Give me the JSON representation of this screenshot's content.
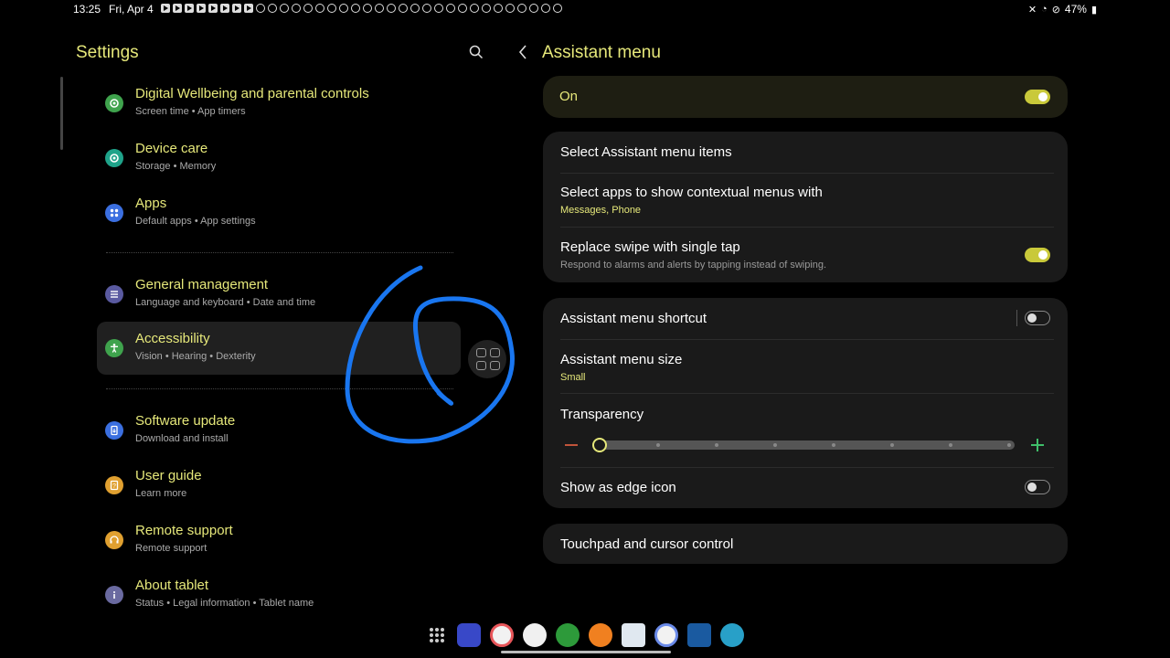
{
  "status": {
    "time": "13:25",
    "date": "Fri, Apr 4",
    "battery": "47%"
  },
  "left": {
    "title": "Settings",
    "items": [
      {
        "title": "Digital Wellbeing and parental controls",
        "sub": "Screen time  •  App timers",
        "color": "#3fa34d"
      },
      {
        "title": "Device care",
        "sub": "Storage  •  Memory",
        "color": "#1fa38a"
      },
      {
        "title": "Apps",
        "sub": "Default apps  •  App settings",
        "color": "#3b6fe0"
      },
      {
        "title": "General management",
        "sub": "Language and keyboard  •  Date and time",
        "color": "#5a5aa0"
      },
      {
        "title": "Accessibility",
        "sub": "Vision  •  Hearing  •  Dexterity",
        "color": "#3fa34d"
      },
      {
        "title": "Software update",
        "sub": "Download and install",
        "color": "#3b6fe0"
      },
      {
        "title": "User guide",
        "sub": "Learn more",
        "color": "#e0a030"
      },
      {
        "title": "Remote support",
        "sub": "Remote support",
        "color": "#e0a030"
      },
      {
        "title": "About tablet",
        "sub": "Status  •  Legal information  •  Tablet name",
        "color": "#6a6aa0"
      }
    ]
  },
  "right": {
    "title": "Assistant menu",
    "on_label": "On",
    "main_toggle": true,
    "group1": {
      "select_items": "Select Assistant menu items",
      "contextual_title": "Select apps to show contextual menus with",
      "contextual_sub": "Messages, Phone",
      "replace_title": "Replace swipe with single tap",
      "replace_sub": "Respond to alarms and alerts by tapping instead of swiping.",
      "replace_toggle": true
    },
    "group2": {
      "shortcut_title": "Assistant menu shortcut",
      "shortcut_toggle": false,
      "size_title": "Assistant menu size",
      "size_sub": "Small",
      "transparency_title": "Transparency",
      "transparency_level": 0,
      "edge_title": "Show as edge icon",
      "edge_toggle": false
    },
    "touchpad_title": "Touchpad and cursor control"
  },
  "accent_color": "#e6e87a"
}
